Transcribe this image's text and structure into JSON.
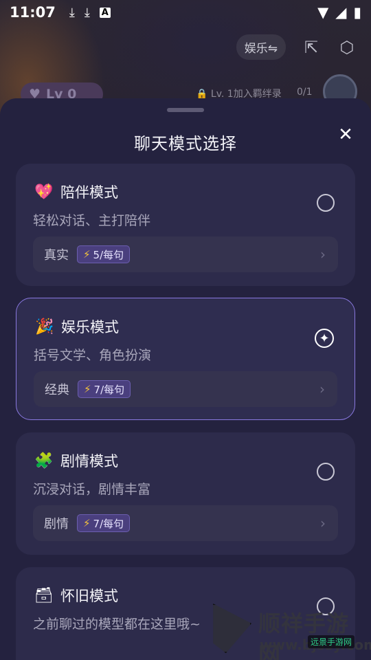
{
  "statusbar": {
    "time": "11:07",
    "icons": [
      "download-icon",
      "download-icon",
      "a-icon"
    ],
    "right_icons": [
      "wifi-icon",
      "signal-icon",
      "battery-icon"
    ]
  },
  "background": {
    "mode_pill": "娱乐⇋",
    "level_badge": "Lv 0",
    "level_text": "Lv. 1加入羁绊录",
    "level_count": "0/1"
  },
  "sheet": {
    "title": "聊天模式选择",
    "close_glyph": "✕"
  },
  "modes": [
    {
      "emoji": "💖",
      "title": "陪伴模式",
      "subtitle": "轻松对话、主打陪伴",
      "sub_label": "真实",
      "cost": "5/每句",
      "selected": false
    },
    {
      "emoji": "🎉",
      "title": "娱乐模式",
      "subtitle": "括号文学、角色扮演",
      "sub_label": "经典",
      "cost": "7/每句",
      "selected": true
    },
    {
      "emoji": "🧩",
      "title": "剧情模式",
      "subtitle": "沉浸对话，剧情丰富",
      "sub_label": "剧情",
      "cost": "7/每句",
      "selected": false
    },
    {
      "emoji": "🗃",
      "title": "怀旧模式",
      "subtitle": "之前聊过的模型都在这里哦~",
      "selected": false
    }
  ],
  "watermark": {
    "text": "顺祥手游网",
    "url": "www.bjssy.com",
    "small": "远景手游网"
  },
  "colors": {
    "sheet_bg": "#24223f",
    "card_bg": "#2d2b4b",
    "selected_border": "#8a79e0",
    "cost_badge": "#4a3f7e",
    "bolt": "#f6c53b"
  }
}
